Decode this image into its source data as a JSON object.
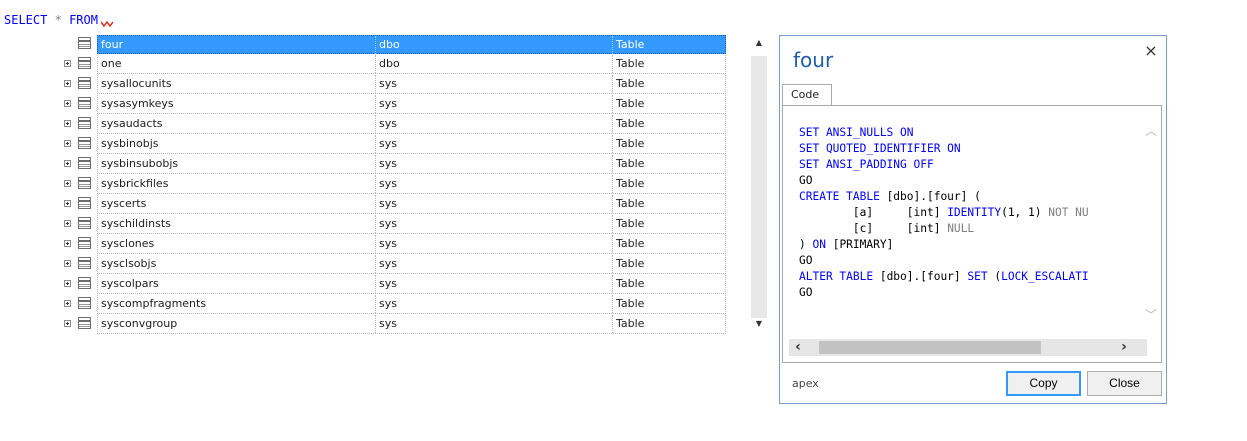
{
  "editor": {
    "keyword_select": "SELECT",
    "operator_star": "*",
    "keyword_from": "FROM"
  },
  "suggestions": [
    {
      "name": "four",
      "schema": "dbo",
      "type": "Table",
      "selected": true,
      "expandable": false
    },
    {
      "name": "one",
      "schema": "dbo",
      "type": "Table",
      "selected": false,
      "expandable": true
    },
    {
      "name": "sysallocunits",
      "schema": "sys",
      "type": "Table",
      "selected": false,
      "expandable": true
    },
    {
      "name": "sysasymkeys",
      "schema": "sys",
      "type": "Table",
      "selected": false,
      "expandable": true
    },
    {
      "name": "sysaudacts",
      "schema": "sys",
      "type": "Table",
      "selected": false,
      "expandable": true
    },
    {
      "name": "sysbinobjs",
      "schema": "sys",
      "type": "Table",
      "selected": false,
      "expandable": true
    },
    {
      "name": "sysbinsubobjs",
      "schema": "sys",
      "type": "Table",
      "selected": false,
      "expandable": true
    },
    {
      "name": "sysbrickfiles",
      "schema": "sys",
      "type": "Table",
      "selected": false,
      "expandable": true
    },
    {
      "name": "syscerts",
      "schema": "sys",
      "type": "Table",
      "selected": false,
      "expandable": true
    },
    {
      "name": "syschildinsts",
      "schema": "sys",
      "type": "Table",
      "selected": false,
      "expandable": true
    },
    {
      "name": "sysclones",
      "schema": "sys",
      "type": "Table",
      "selected": false,
      "expandable": true
    },
    {
      "name": "sysclsobjs",
      "schema": "sys",
      "type": "Table",
      "selected": false,
      "expandable": true
    },
    {
      "name": "syscolpars",
      "schema": "sys",
      "type": "Table",
      "selected": false,
      "expandable": true
    },
    {
      "name": "syscompfragments",
      "schema": "sys",
      "type": "Table",
      "selected": false,
      "expandable": true
    },
    {
      "name": "sysconvgroup",
      "schema": "sys",
      "type": "Table",
      "selected": false,
      "expandable": true
    }
  ],
  "popup": {
    "title": "four",
    "tab_label": "Code",
    "code_lines": [
      [
        {
          "t": "SET ANSI_NULLS ON",
          "c": "kw"
        }
      ],
      [
        {
          "t": "SET QUOTED_IDENTIFIER ON",
          "c": "kw"
        }
      ],
      [
        {
          "t": "SET ANSI_PADDING OFF",
          "c": "kw"
        }
      ],
      [
        {
          "t": "GO",
          "c": ""
        }
      ],
      [
        {
          "t": "CREATE TABLE",
          "c": "kw"
        },
        {
          "t": " [dbo].[four] (",
          "c": ""
        }
      ],
      [
        {
          "t": "        [a]     [int] ",
          "c": ""
        },
        {
          "t": "IDENTITY",
          "c": "kw"
        },
        {
          "t": "(1, 1) ",
          "c": ""
        },
        {
          "t": "NOT NU",
          "c": "gr"
        }
      ],
      [
        {
          "t": "        [c]     [int] ",
          "c": ""
        },
        {
          "t": "NULL",
          "c": "gr"
        }
      ],
      [
        {
          "t": ") ",
          "c": ""
        },
        {
          "t": "ON",
          "c": "kw"
        },
        {
          "t": " [PRIMARY]",
          "c": ""
        }
      ],
      [
        {
          "t": "GO",
          "c": ""
        }
      ],
      [
        {
          "t": "ALTER TABLE",
          "c": "kw"
        },
        {
          "t": " [dbo].[four] ",
          "c": ""
        },
        {
          "t": "SET",
          "c": "kw"
        },
        {
          "t": " (",
          "c": ""
        },
        {
          "t": "LOCK_ESCALATI",
          "c": "kw"
        }
      ],
      [
        {
          "t": "GO",
          "c": ""
        }
      ]
    ],
    "footer_text": "apex",
    "copy_label": "Copy",
    "close_label": "Close"
  },
  "icons": {
    "close": "close-icon",
    "table": "table-icon",
    "expand": "plus-expander-icon",
    "scroll_up": "scroll-up-icon",
    "scroll_down": "scroll-down-icon",
    "scroll_left": "scroll-left-icon",
    "scroll_right": "scroll-right-icon"
  },
  "colors": {
    "selection": "#3399ff",
    "keyword": "#0000ff",
    "title": "#1f5fa8",
    "muted_keyword": "#808080"
  }
}
